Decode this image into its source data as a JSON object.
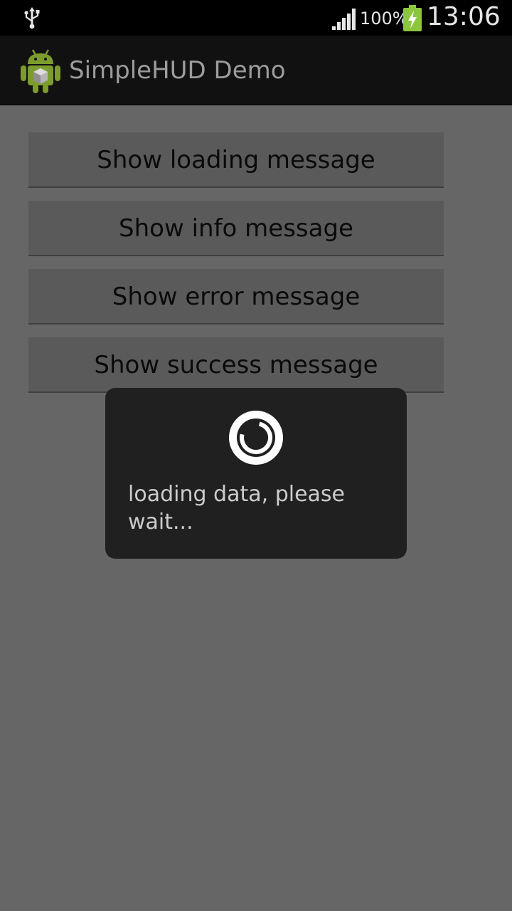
{
  "status_bar": {
    "battery_percent": "100%",
    "time": "13:06",
    "icons": [
      "usb-icon",
      "signal-icon",
      "battery-charging-icon"
    ]
  },
  "action_bar": {
    "app_icon": "android-app-icon",
    "title": "SimpleHUD Demo"
  },
  "buttons": [
    {
      "label": "Show loading message"
    },
    {
      "label": "Show info message"
    },
    {
      "label": "Show error message"
    },
    {
      "label": "Show success message"
    }
  ],
  "hud": {
    "icon": "loading-spinner-icon",
    "message": "loading data, please wait..."
  },
  "colors": {
    "background": "#666666",
    "battery_green": "#8cc63f",
    "hud_background": "#202020"
  }
}
